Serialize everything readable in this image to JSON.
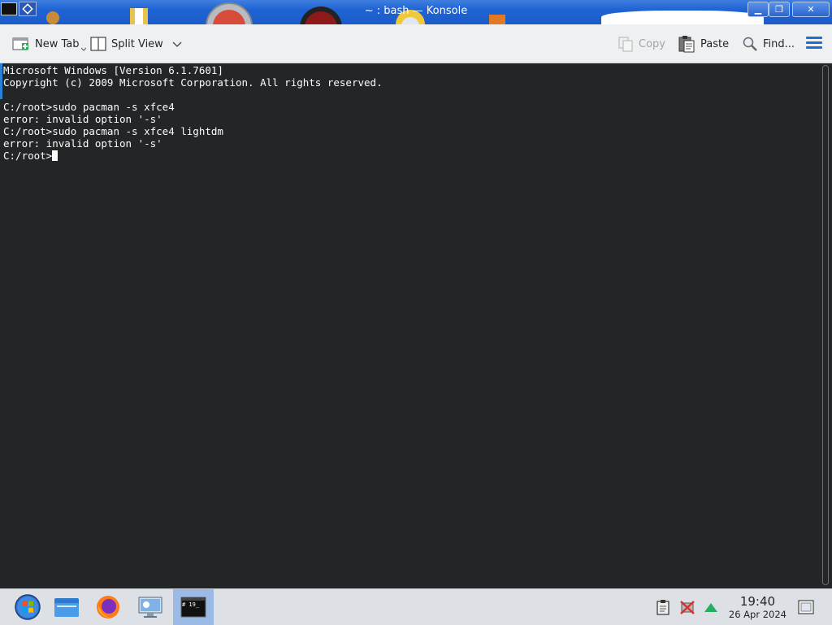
{
  "window": {
    "title": "~ : bash — Konsole",
    "controls": {
      "minimize": "▁",
      "maximize": "❐",
      "close": "✕"
    }
  },
  "toolbar": {
    "new_tab": "New Tab",
    "split_view": "Split View",
    "copy": "Copy",
    "paste": "Paste",
    "find": "Find..."
  },
  "terminal": {
    "lines": [
      "Microsoft Windows [Version 6.1.7601]",
      "Copyright (c) 2009 Microsoft Corporation. All rights reserved.",
      "",
      "C:/root>sudo pacman -s xfce4",
      "error: invalid option '-s'",
      "C:/root>sudo pacman -s xfce4 lightdm",
      "error: invalid option '-s'"
    ],
    "prompt": "C:/root>"
  },
  "taskbar": {
    "clock_time": "19:40",
    "clock_date": "26 Apr 2024",
    "active_task_label": "# 19_"
  },
  "colors": {
    "terminal_bg": "#232627",
    "terminal_fg": "#fcfcfc",
    "accent": "#2980d9",
    "titlebar": "#1f63d3"
  }
}
